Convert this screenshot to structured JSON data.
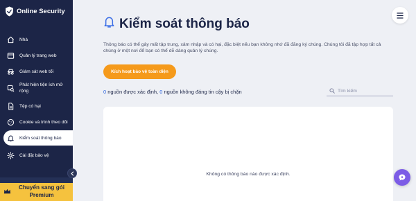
{
  "brand": {
    "name": "Online Security",
    "icon": "shield-check-icon"
  },
  "sidebar": {
    "items": [
      {
        "label": "Nhà",
        "icon": "home-icon",
        "active": false
      },
      {
        "label": "Quản lý trang web",
        "icon": "browser-window-icon",
        "active": false
      },
      {
        "label": "Giám sát web tối",
        "icon": "incognito-icon",
        "active": false
      },
      {
        "label": "Phát hiện tiện ích mở rộng",
        "icon": "extension-scan-icon",
        "active": false
      },
      {
        "label": "Tệp có hại",
        "icon": "file-icon",
        "active": false
      },
      {
        "label": "Cookie và trình theo dõi",
        "icon": "cookie-icon",
        "active": false
      },
      {
        "label": "Kiểm soát thông báo",
        "icon": "bell-icon",
        "active": true
      },
      {
        "label": "Cài đặt bảo vệ",
        "icon": "gear-icon",
        "active": false
      }
    ],
    "premium_label": "Chuyển sang gói Premium"
  },
  "main": {
    "title": "Kiểm soát thông báo",
    "description": "Thông báo có thể gây mất tập trung, xâm nhập và có hại, đặc biệt nếu bạn không nhớ đã đăng ký chúng. Chúng tôi đã tập hợp tất cả chúng ở một nơi để bạn có thể dễ dàng quản lý chúng.",
    "activate_button": "Kích hoạt bảo vệ toàn diện",
    "stats": {
      "identified_count": "0",
      "identified_label": " nguồn được xác định, ",
      "untrusted_count": "0",
      "untrusted_label": " nguồn không đáng tin cậy bị chặn"
    },
    "search_placeholder": "Tìm kiếm",
    "empty_message": "Không có thông báo nào được xác định."
  },
  "colors": {
    "sidebar_bg": "#1c2547",
    "accent_orange": "#f59a1b",
    "premium_yellow": "#f5c23e",
    "link_blue": "#2f66e0",
    "chat_purple": "#7c5ce6"
  }
}
